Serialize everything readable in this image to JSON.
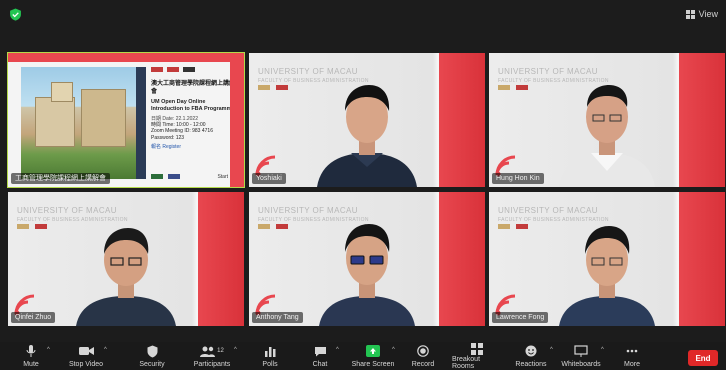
{
  "window": {
    "view_label": "View"
  },
  "slide": {
    "title_zh": "澳大工商管理學院課程網上講解會",
    "title_en": "UM Open Day Online Introduction to FBA Programme",
    "details": [
      "日期 Date: 22.1.2022",
      "時間 Time: 10:00 - 12:00",
      "Zoom Meeting ID: 983 4716",
      "Password: 123"
    ],
    "link_label": "報名 Register",
    "footer_left": "Register",
    "footer_right": "Start"
  },
  "participants": [
    {
      "name": "工商管理學院課程網上講解會",
      "type": "slide"
    },
    {
      "name": "Yoshiaki",
      "type": "video"
    },
    {
      "name": "Hung Hon Kin",
      "type": "video"
    },
    {
      "name": "Qinfei Zhuo",
      "type": "video"
    },
    {
      "name": "Anthony Tang",
      "type": "video"
    },
    {
      "name": "Lawrence Fong",
      "type": "video"
    }
  ],
  "background": {
    "university": "UNIVERSITY OF MACAU",
    "faculty": "FACULTY OF BUSINESS ADMINISTRATION"
  },
  "toolbar": {
    "mute": "Mute",
    "stop_video": "Stop Video",
    "security": "Security",
    "participants": "Participants",
    "participants_count": "12",
    "polls": "Polls",
    "chat": "Chat",
    "share_screen": "Share Screen",
    "record": "Record",
    "breakout_rooms": "Breakout Rooms",
    "reactions": "Reactions",
    "whiteboards": "Whiteboards",
    "more": "More",
    "end": "End"
  },
  "colors": {
    "accent_red": "#e8474f",
    "share_green": "#23c552",
    "active_speaker": "#b3d94a",
    "end_red": "#e02828"
  }
}
